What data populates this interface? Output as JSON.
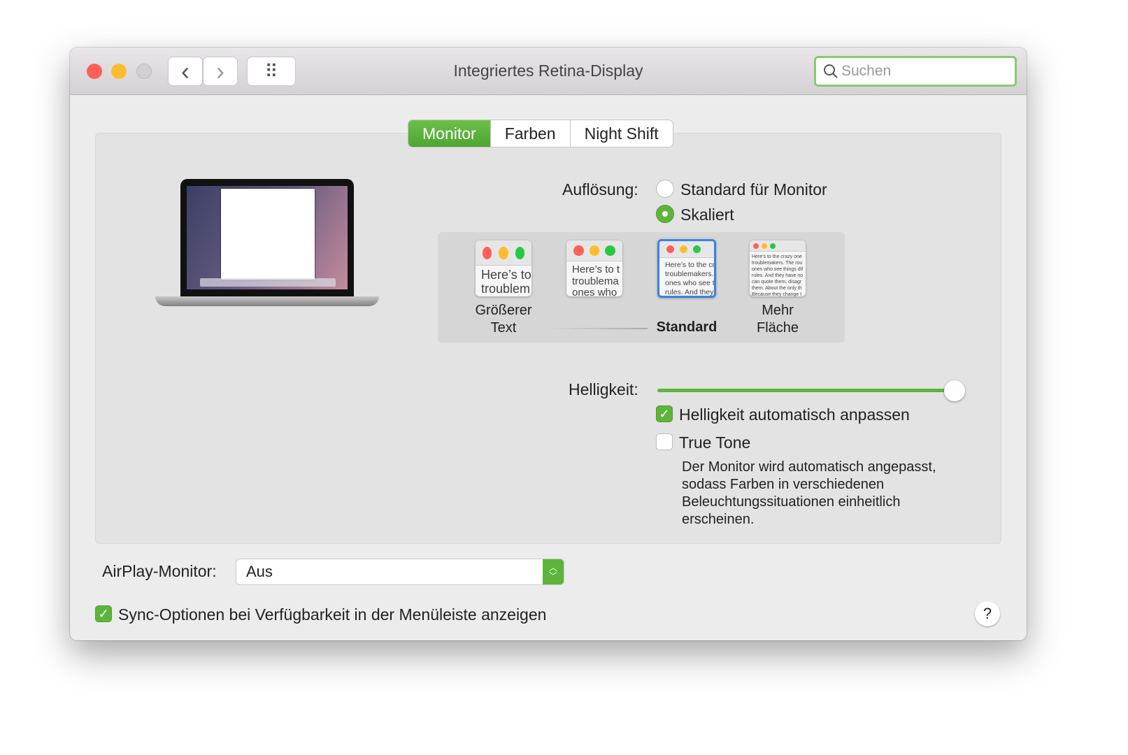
{
  "window": {
    "title": "Integriertes Retina-Display",
    "search_placeholder": "Suchen"
  },
  "toolbar": {
    "back": "‹",
    "forward": "›",
    "grid": "⠿"
  },
  "tabs": [
    {
      "label": "Monitor",
      "active": true
    },
    {
      "label": "Farben"
    },
    {
      "label": "Night Shift"
    }
  ],
  "resolution": {
    "label": "Auflösung:",
    "options": [
      {
        "label": "Standard für Monitor",
        "selected": false
      },
      {
        "label": "Skaliert",
        "selected": true
      }
    ]
  },
  "scaling": {
    "thumbs": [
      {
        "text": "Here’s to\ntroublem",
        "label": "Größerer Text"
      },
      {
        "text": "Here’s to t\ntroublema\nones who",
        "label": ""
      },
      {
        "text": "Here’s to the cr\ntroublemakers.\nones who see t\nrules. And they",
        "label": "Standard",
        "selected": true
      },
      {
        "text": "Here's to the crazy one\ntroublemakers. The rou\nones who see things dif\nrules. And they have no\ncan quote them, disagr\nthem. About the only th\nBecause they change t",
        "label": "Mehr Fläche"
      }
    ]
  },
  "brightness": {
    "label": "Helligkeit:",
    "value": 0.97,
    "auto_label": "Helligkeit automatisch anpassen",
    "auto_checked": true
  },
  "true_tone": {
    "label": "True Tone",
    "checked": false,
    "description": "Der Monitor wird automatisch angepasst, sodass Farben in verschiedenen Beleuchtungssituationen einheitlich erscheinen."
  },
  "airplay": {
    "label": "AirPlay-Monitor:",
    "value": "Aus"
  },
  "sync": {
    "label": "Sync-Optionen bei Verfügbarkeit in der Menüleiste anzeigen",
    "checked": true
  },
  "help": "?",
  "colors": {
    "accent": "#5cb53a",
    "selection": "#3a83e0"
  }
}
